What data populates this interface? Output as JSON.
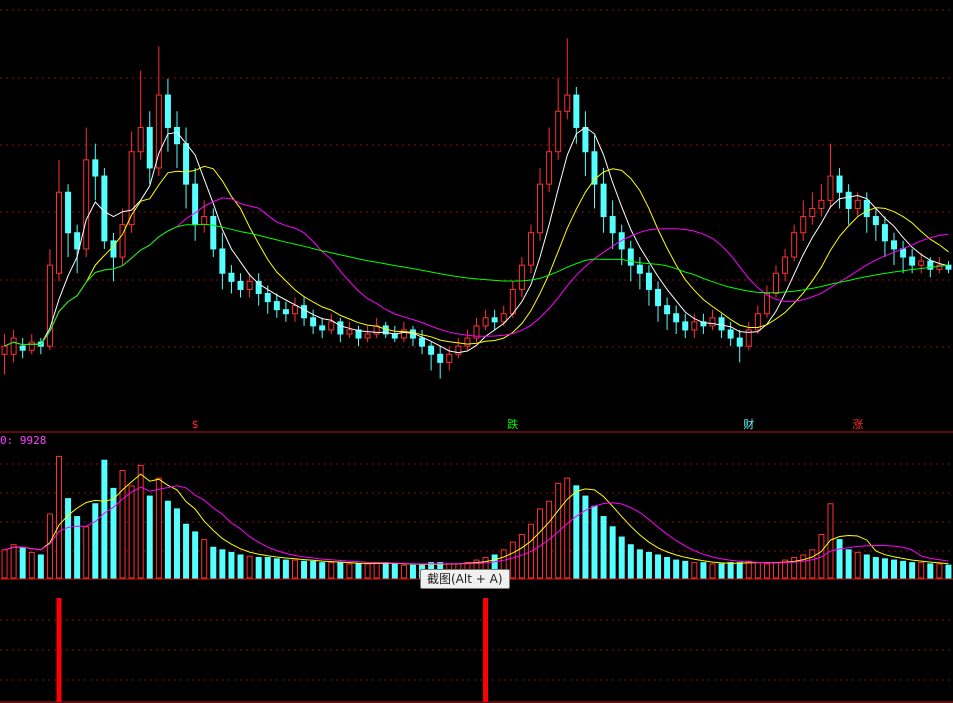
{
  "chart_data": [
    {
      "type": "candlestick",
      "panel": "price",
      "ylim": [
        0,
        100
      ],
      "grid": true,
      "overlays": [
        {
          "name": "",
          "color": "#ffffff"
        },
        {
          "name": "",
          "color": "#ffff00"
        },
        {
          "name": "",
          "color": "#ff00ff"
        },
        {
          "name": "",
          "color": "#00ff00"
        }
      ],
      "markers": [
        {
          "label": "$",
          "bar": 21,
          "color": "#ff3030"
        },
        {
          "label": "跌",
          "bar": 56,
          "color": "#00ff00"
        },
        {
          "label": "财",
          "bar": 82,
          "color": "#55ffff"
        },
        {
          "label": "涨",
          "bar": 94,
          "color": "#ff3030"
        }
      ],
      "candles": [
        [
          40,
          42,
          45,
          35
        ],
        [
          40,
          44,
          46,
          38
        ],
        [
          42,
          41,
          44,
          39
        ],
        [
          41,
          43,
          45,
          40
        ],
        [
          43,
          42,
          44,
          40
        ],
        [
          42,
          62,
          66,
          41
        ],
        [
          60,
          80,
          88,
          58
        ],
        [
          80,
          70,
          82,
          64
        ],
        [
          70,
          66,
          72,
          60
        ],
        [
          66,
          88,
          96,
          64
        ],
        [
          88,
          84,
          92,
          78
        ],
        [
          84,
          68,
          86,
          66
        ],
        [
          68,
          64,
          70,
          58
        ],
        [
          64,
          72,
          76,
          62
        ],
        [
          72,
          90,
          95,
          70
        ],
        [
          90,
          96,
          110,
          88
        ],
        [
          96,
          86,
          100,
          82
        ],
        [
          86,
          104,
          116,
          84
        ],
        [
          104,
          96,
          108,
          90
        ],
        [
          96,
          92,
          100,
          86
        ],
        [
          92,
          82,
          96,
          76
        ],
        [
          82,
          72,
          86,
          68
        ],
        [
          72,
          74,
          78,
          70
        ],
        [
          74,
          66,
          76,
          64
        ],
        [
          66,
          60,
          70,
          56
        ],
        [
          60,
          58,
          62,
          55
        ],
        [
          58,
          56,
          60,
          54
        ],
        [
          56,
          58,
          60,
          54
        ],
        [
          58,
          55,
          60,
          52
        ],
        [
          55,
          53,
          57,
          50
        ],
        [
          53,
          51,
          55,
          49
        ],
        [
          51,
          50,
          53,
          48
        ],
        [
          50,
          52,
          54,
          48
        ],
        [
          52,
          49,
          54,
          47
        ],
        [
          49,
          47,
          51,
          45
        ],
        [
          47,
          46,
          49,
          44
        ],
        [
          46,
          48,
          50,
          45
        ],
        [
          48,
          45,
          49,
          43
        ],
        [
          45,
          46,
          48,
          44
        ],
        [
          46,
          44,
          47,
          42
        ],
        [
          44,
          45,
          47,
          43
        ],
        [
          45,
          47,
          49,
          44
        ],
        [
          47,
          45,
          48,
          44
        ],
        [
          45,
          44,
          47,
          43
        ],
        [
          44,
          46,
          48,
          43
        ],
        [
          46,
          44,
          47,
          42
        ],
        [
          44,
          42,
          46,
          40
        ],
        [
          42,
          40,
          43,
          36
        ],
        [
          40,
          38,
          42,
          34
        ],
        [
          38,
          40,
          42,
          36
        ],
        [
          40,
          42,
          44,
          39
        ],
        [
          42,
          44,
          46,
          41
        ],
        [
          44,
          47,
          49,
          43
        ],
        [
          47,
          49,
          51,
          46
        ],
        [
          49,
          48,
          51,
          46
        ],
        [
          48,
          50,
          52,
          47
        ],
        [
          50,
          56,
          58,
          49
        ],
        [
          56,
          62,
          64,
          54
        ],
        [
          62,
          70,
          72,
          60
        ],
        [
          70,
          82,
          86,
          68
        ],
        [
          82,
          90,
          96,
          80
        ],
        [
          90,
          100,
          108,
          88
        ],
        [
          100,
          104,
          118,
          98
        ],
        [
          104,
          96,
          106,
          92
        ],
        [
          96,
          90,
          100,
          84
        ],
        [
          90,
          82,
          94,
          76
        ],
        [
          82,
          74,
          86,
          70
        ],
        [
          74,
          70,
          78,
          66
        ],
        [
          70,
          66,
          72,
          62
        ],
        [
          66,
          62,
          68,
          58
        ],
        [
          62,
          60,
          64,
          56
        ],
        [
          60,
          56,
          62,
          52
        ],
        [
          56,
          52,
          58,
          48
        ],
        [
          52,
          50,
          54,
          46
        ],
        [
          50,
          48,
          52,
          45
        ],
        [
          48,
          46,
          50,
          44
        ],
        [
          46,
          48,
          50,
          44
        ],
        [
          48,
          47,
          50,
          45
        ],
        [
          47,
          49,
          51,
          46
        ],
        [
          49,
          46,
          50,
          44
        ],
        [
          46,
          44,
          48,
          42
        ],
        [
          44,
          42,
          46,
          38
        ],
        [
          42,
          46,
          48,
          41
        ],
        [
          46,
          50,
          52,
          45
        ],
        [
          50,
          55,
          57,
          49
        ],
        [
          55,
          60,
          62,
          54
        ],
        [
          60,
          64,
          66,
          58
        ],
        [
          64,
          70,
          72,
          63
        ],
        [
          70,
          74,
          78,
          68
        ],
        [
          74,
          76,
          80,
          72
        ],
        [
          76,
          78,
          82,
          74
        ],
        [
          78,
          84,
          92,
          76
        ],
        [
          84,
          80,
          86,
          76
        ],
        [
          80,
          76,
          82,
          72
        ],
        [
          76,
          78,
          80,
          74
        ],
        [
          78,
          74,
          80,
          70
        ],
        [
          74,
          72,
          76,
          68
        ],
        [
          72,
          68,
          74,
          64
        ],
        [
          68,
          66,
          70,
          62
        ],
        [
          66,
          64,
          68,
          60
        ],
        [
          64,
          62,
          66,
          60
        ],
        [
          62,
          63,
          65,
          60
        ],
        [
          63,
          61,
          64,
          59
        ],
        [
          61,
          62,
          64,
          60
        ],
        [
          62,
          61,
          63,
          60
        ]
      ]
    },
    {
      "type": "bar",
      "panel": "volume",
      "label": "0: 9928",
      "label_color": "#ff40ff",
      "ylim": [
        0,
        100
      ],
      "overlays": [
        {
          "name": "",
          "color": "#ffff00"
        },
        {
          "name": "",
          "color": "#ff00ff"
        }
      ],
      "values": [
        22,
        26,
        24,
        20,
        18,
        50,
        95,
        62,
        48,
        40,
        58,
        92,
        70,
        84,
        72,
        88,
        64,
        78,
        60,
        54,
        42,
        36,
        30,
        24,
        22,
        20,
        18,
        17,
        16,
        16,
        15,
        14,
        14,
        13,
        13,
        12,
        12,
        12,
        11,
        11,
        11,
        12,
        12,
        11,
        10,
        10,
        10,
        12,
        12,
        11,
        11,
        12,
        14,
        16,
        18,
        22,
        28,
        34,
        42,
        54,
        60,
        74,
        78,
        72,
        64,
        56,
        48,
        40,
        32,
        26,
        22,
        20,
        18,
        16,
        14,
        13,
        12,
        12,
        11,
        11,
        12,
        12,
        13,
        12,
        11,
        12,
        14,
        16,
        18,
        22,
        34,
        58,
        30,
        22,
        20,
        18,
        16,
        15,
        14,
        13,
        12,
        12,
        11,
        11,
        10
      ],
      "colors_up": "#ff3030",
      "colors_down": "#55ffff"
    },
    {
      "type": "bar",
      "panel": "signal",
      "signals": [
        {
          "bar": 6,
          "value": 100
        },
        {
          "bar": 53,
          "value": 100
        }
      ],
      "color": "#ff0000"
    }
  ],
  "tooltip": {
    "text": "截图(Alt + A)"
  }
}
